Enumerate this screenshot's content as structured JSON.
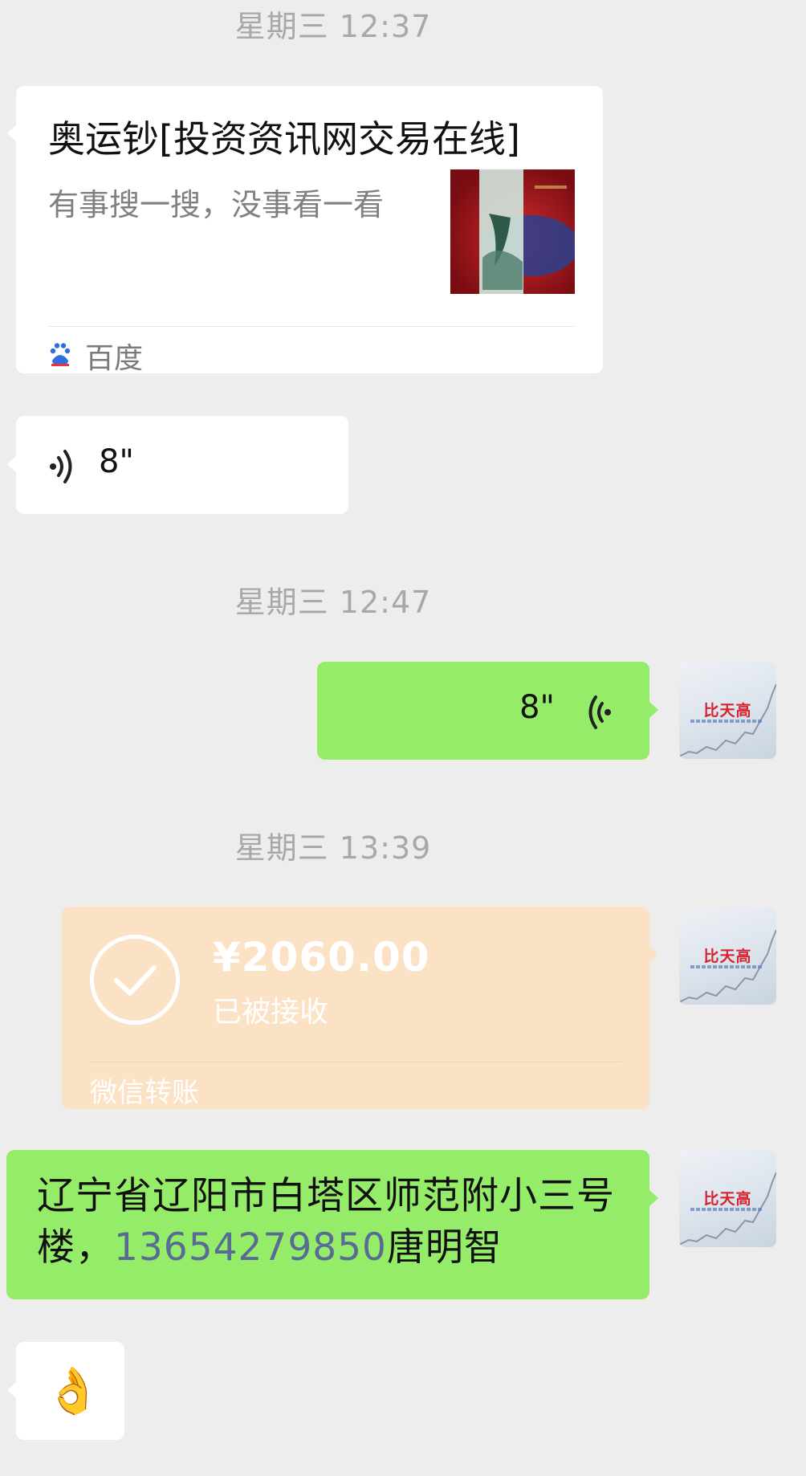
{
  "timestamps": [
    "星期三 12:37",
    "星期三 12:47",
    "星期三 13:39"
  ],
  "link_card": {
    "title": "奥运钞[投资资讯网交易在线]",
    "description": "有事搜一搜，没事看一看",
    "source": "百度",
    "source_icon": "baidu-paw-icon"
  },
  "voice_received": {
    "duration": "8\"",
    "icon": "voice-wave-icon"
  },
  "voice_sent": {
    "duration": "8\"",
    "icon": "voice-wave-icon"
  },
  "transfer": {
    "amount": "¥2060.00",
    "status": "已被接收",
    "label": "微信转账",
    "icon": "check-circle-icon"
  },
  "address_message": {
    "text_before": "辽宁省辽阳市白塔区师范附小三号楼，",
    "phone": "13654279850",
    "text_after": "唐明智"
  },
  "emoji_message": {
    "emoji": "👌"
  },
  "avatar": {
    "title": "比天高"
  },
  "colors": {
    "background": "#ededed",
    "sent_bubble": "#95ec69",
    "received_bubble": "#ffffff",
    "transfer_bubble": "#fbe2c4",
    "timestamp": "#a8a8a8",
    "link": "#576b95"
  }
}
